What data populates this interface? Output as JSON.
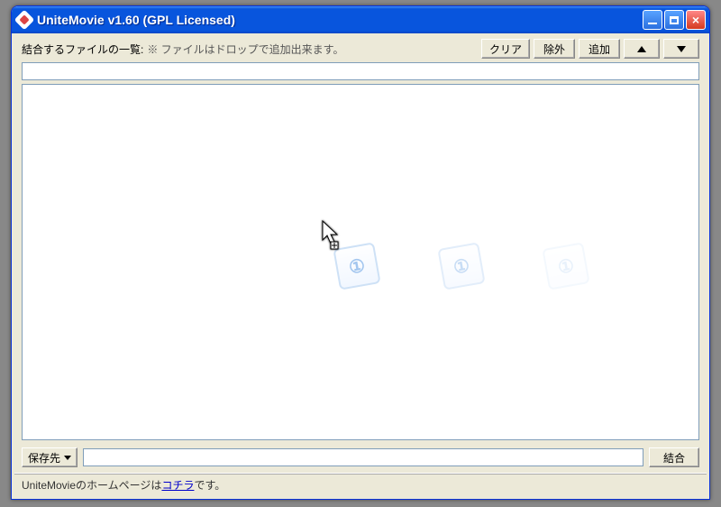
{
  "window": {
    "title": "UniteMovie v1.60 (GPL Licensed)"
  },
  "toolbar": {
    "list_label": "結合するファイルの一覧:",
    "hint": "※ ファイルはドロップで追加出来ます。",
    "clear": "クリア",
    "remove": "除外",
    "add": "追加"
  },
  "path": {
    "value": ""
  },
  "ghost": {
    "glyph": "①"
  },
  "bottom": {
    "save_to": "保存先",
    "save_path": "",
    "join": "結合"
  },
  "status": {
    "prefix": "UniteMovieのホームページは",
    "link": "コチラ",
    "suffix": "です。"
  }
}
